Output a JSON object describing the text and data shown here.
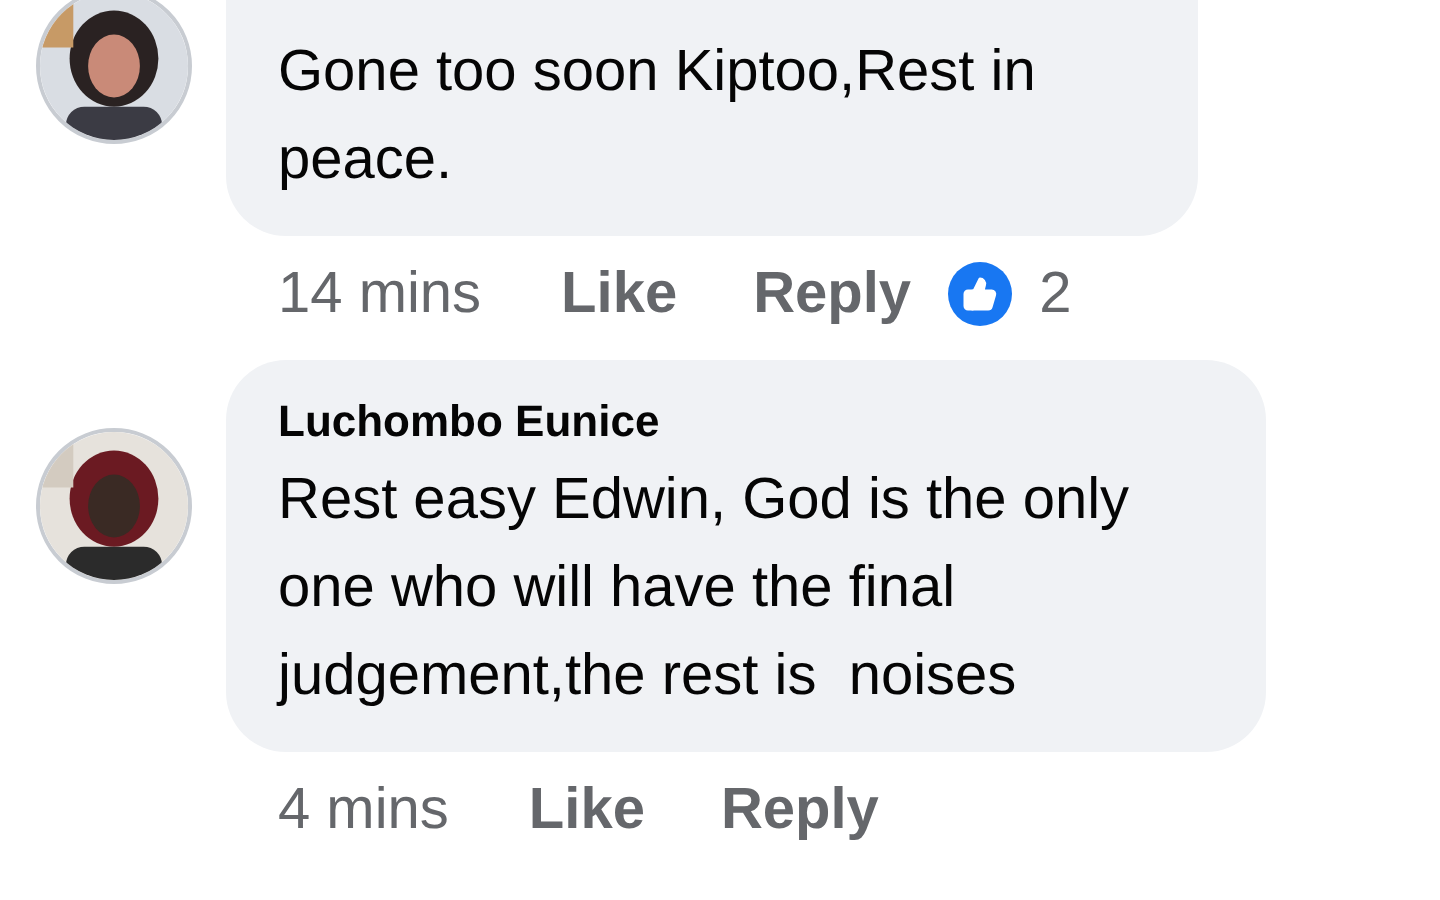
{
  "comments": [
    {
      "text": "Gone too soon Kiptoo,Rest in peace.",
      "time": "14 mins",
      "actions": [
        "Like",
        "Reply"
      ],
      "reaction_count": "2"
    },
    {
      "author": "Luchombo Eunice",
      "text": "Rest easy Edwin, God is the only one who will have the final judgement,the rest is  noises",
      "time": "4 mins",
      "actions": [
        "Like",
        "Reply"
      ]
    }
  ]
}
